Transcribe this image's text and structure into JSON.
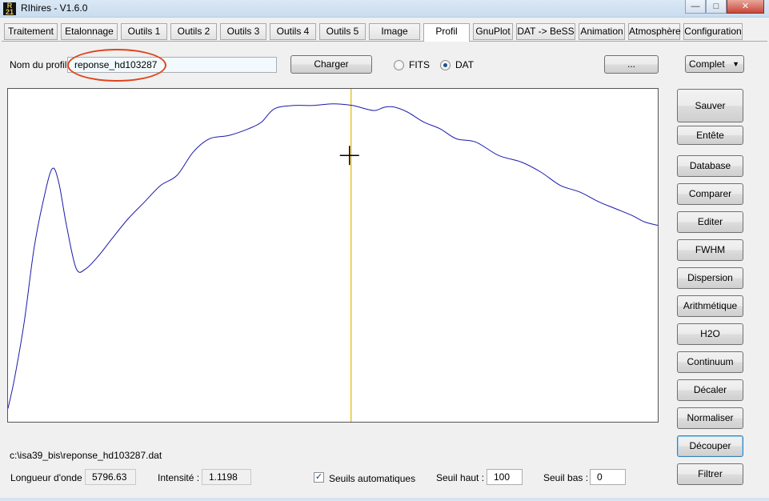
{
  "window": {
    "title": "RIhires - V1.6.0",
    "icon": "app-logo-icon",
    "minimize_glyph": "—",
    "maximize_glyph": "□",
    "close_glyph": "✕"
  },
  "tabs": [
    {
      "label": "Traitement"
    },
    {
      "label": "Etalonnage"
    },
    {
      "label": "Outils 1"
    },
    {
      "label": "Outils 2"
    },
    {
      "label": "Outils 3"
    },
    {
      "label": "Outils 4"
    },
    {
      "label": "Outils 5"
    },
    {
      "label": "Image"
    },
    {
      "label": "Profil",
      "active": true
    },
    {
      "label": "GnuPlot"
    },
    {
      "label": "DAT -> BeSS"
    },
    {
      "label": "Animation"
    },
    {
      "label": "Atmosphère"
    },
    {
      "label": "Configuration"
    }
  ],
  "profile": {
    "name_label": "Nom du profil :",
    "name_value": "reponse_hd103287",
    "load_button": "Charger",
    "format_options": [
      {
        "label": "FITS",
        "selected": false
      },
      {
        "label": "DAT",
        "selected": true
      }
    ],
    "browse_button": "...",
    "mode_select": "Complet",
    "mode_select_arrow": "▼"
  },
  "side_buttons": {
    "save": "Sauver",
    "header": "Entête",
    "database": "Database",
    "compare": "Comparer",
    "edit": "Editer",
    "fwhm": "FWHM",
    "dispersion": "Dispersion",
    "arithmetic": "Arithmétique",
    "h2o": "H2O",
    "continuum": "Continuum",
    "shift": "Décaler",
    "normalize": "Normaliser",
    "crop": "Découper",
    "filter": "Filtrer"
  },
  "status": {
    "file_path": "c:\\isa39_bis\\reponse_hd103287.dat",
    "wavelength_label": "Longueur d'onde :",
    "wavelength_value": "5796.63",
    "intensity_label": "Intensité :",
    "intensity_value": "1.1198",
    "auto_thresholds_label": "Seuils automatiques",
    "auto_thresholds_checked": true,
    "auto_thresholds_check_glyph": "✓",
    "high_threshold_label": "Seuil haut :",
    "high_threshold_value": "100",
    "low_threshold_label": "Seuil bas :",
    "low_threshold_value": "0"
  },
  "colors": {
    "profile_curve": "#1a1aaa",
    "cursor_line": "#e3b400",
    "annotation": "#e0431c"
  },
  "chart_data": {
    "type": "line",
    "title": "",
    "xlabel": "",
    "ylabel": "",
    "grid": false,
    "series": [
      {
        "values": [
          [
            0,
            0.04
          ],
          [
            0.01,
            0.13
          ],
          [
            0.025,
            0.3
          ],
          [
            0.04,
            0.52
          ],
          [
            0.055,
            0.67
          ],
          [
            0.068,
            0.76
          ],
          [
            0.078,
            0.72
          ],
          [
            0.09,
            0.59
          ],
          [
            0.105,
            0.46
          ],
          [
            0.12,
            0.46
          ],
          [
            0.14,
            0.5
          ],
          [
            0.16,
            0.55
          ],
          [
            0.185,
            0.61
          ],
          [
            0.21,
            0.66
          ],
          [
            0.235,
            0.71
          ],
          [
            0.26,
            0.74
          ],
          [
            0.285,
            0.81
          ],
          [
            0.31,
            0.85
          ],
          [
            0.34,
            0.86
          ],
          [
            0.37,
            0.88
          ],
          [
            0.39,
            0.9
          ],
          [
            0.41,
            0.94
          ],
          [
            0.44,
            0.95
          ],
          [
            0.47,
            0.95
          ],
          [
            0.5,
            0.955
          ],
          [
            0.53,
            0.95
          ],
          [
            0.55,
            0.94
          ],
          [
            0.565,
            0.935
          ],
          [
            0.58,
            0.945
          ],
          [
            0.595,
            0.945
          ],
          [
            0.615,
            0.93
          ],
          [
            0.64,
            0.9
          ],
          [
            0.665,
            0.88
          ],
          [
            0.69,
            0.85
          ],
          [
            0.72,
            0.84
          ],
          [
            0.755,
            0.8
          ],
          [
            0.79,
            0.78
          ],
          [
            0.82,
            0.75
          ],
          [
            0.85,
            0.71
          ],
          [
            0.88,
            0.69
          ],
          [
            0.91,
            0.66
          ],
          [
            0.935,
            0.64
          ],
          [
            0.96,
            0.62
          ],
          [
            0.98,
            0.6
          ],
          [
            1.0,
            0.59
          ]
        ]
      }
    ],
    "cursor_x": 0.528,
    "cursor_y": 0.8
  }
}
